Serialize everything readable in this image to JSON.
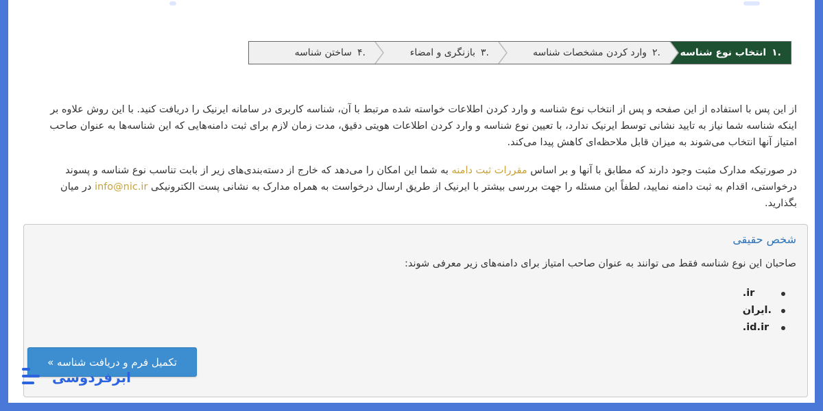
{
  "wizard": {
    "steps": [
      {
        "num": ".۱",
        "label": "انتخاب نوع شناسه",
        "active": true
      },
      {
        "num": ".۲",
        "label": "وارد کردن مشخصات شناسه",
        "active": false
      },
      {
        "num": ".۳",
        "label": "بازنگری و امضاء",
        "active": false
      },
      {
        "num": ".۴",
        "label": "ساختن شناسه",
        "active": false
      }
    ]
  },
  "intro": {
    "paragraph1": "از این پس با استفاده از این صفحه و پس از انتخاب نوع شناسه و وارد کردن اطلاعات خواسته شده مرتبط با آن، شناسه کاربری در سامانه ایرنیک را دریافت کنید. با این روش علاوه بر اینکه شناسه شما نیاز به تایید نشانی توسط ایرنیک ندارد، با تعیین نوع شناسه و وارد کردن اطلاعات هویتی دقیق، مدت زمان لازم برای ثبت دامنه‌هایی که این شناسه‌ها به عنوان صاحب امتیاز آنها انتخاب می‌شوند به میزان قابل ملاحظه‌ای کاهش پیدا می‌کند.",
    "paragraph2_before": "در صورتیکه مدارک مثبت وجود دارند که مطابق با آنها و بر اساس ",
    "paragraph2_link": "مقررات ثبت دامنه",
    "paragraph2_middle": " به شما این امکان را می‌دهد که خارج از دسته‌بندی‌های زیر از بابت تناسب نوع شناسه و پسوند درخواستی، اقدام به ثبت دامنه نمایید، لطفاً این مسئله را جهت بررسی بیشتر با ایرنیک از طریق ارسال درخواست به همراه مدارک به نشانی پست الکترونیکی ",
    "paragraph2_email": "info@nic.ir",
    "paragraph2_after": " در میان بگذارید."
  },
  "panel": {
    "title": "شخص حقیقی",
    "description": "صاحبان این نوع شناسه فقط می توانند به عنوان صاحب امتیاز برای دامنه‌های زیر معرفی شوند:",
    "domains": [
      ".ir",
      ".ایران",
      ".id.ir"
    ]
  },
  "cta": {
    "label": "تکمیل فرم و دریافت شناسه »"
  },
  "logo": {
    "text": "ابرفردوسی"
  },
  "colors": {
    "accent": "#1e5032",
    "link": "#c8a23a",
    "button": "#3d8ed0",
    "brand": "#2c64e0"
  }
}
